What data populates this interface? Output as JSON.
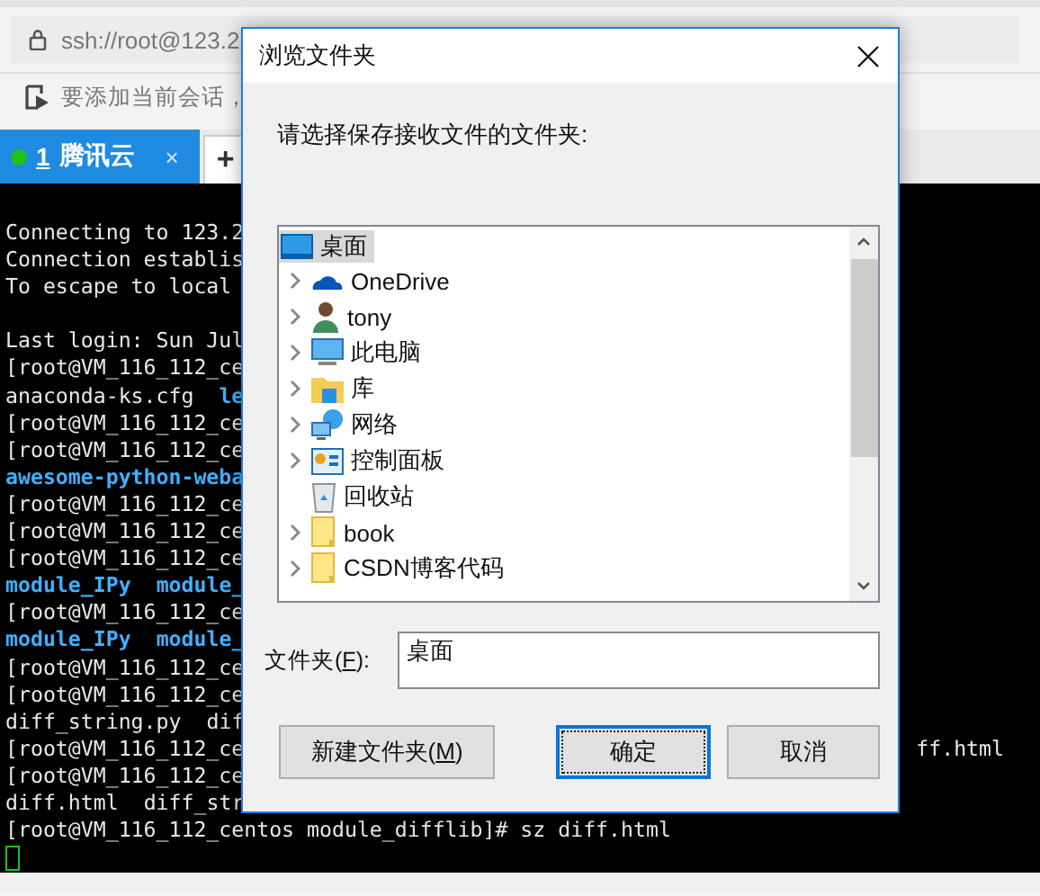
{
  "address_bar": {
    "value": "ssh://root@123.2"
  },
  "toolbar": {
    "hint": "要添加当前会话，"
  },
  "tabs": [
    {
      "number": "1",
      "label": "腾讯云",
      "close": "×",
      "selected": true
    }
  ],
  "new_tab": "+",
  "terminal": {
    "cursor": true,
    "lines": [
      {
        "segments": [
          {
            "text": "Connecting to 123.2",
            "kind": "plain"
          }
        ]
      },
      {
        "segments": [
          {
            "text": "Connection establis",
            "kind": "plain"
          }
        ]
      },
      {
        "segments": [
          {
            "text": "To escape to local",
            "kind": "plain"
          }
        ]
      },
      {
        "kind": "blank"
      },
      {
        "segments": [
          {
            "text": "Last login: Sun Jul",
            "kind": "plain"
          }
        ]
      },
      {
        "segments": [
          {
            "text": "[root@VM_116_112_ce",
            "kind": "plain"
          }
        ]
      },
      {
        "segments": [
          {
            "text": "anaconda-ks.cfg",
            "kind": "plain"
          },
          {
            "text": "le",
            "kind": "dir"
          }
        ]
      },
      {
        "segments": [
          {
            "text": "[root@VM_116_112_ce",
            "kind": "plain"
          }
        ]
      },
      {
        "segments": [
          {
            "text": "[root@VM_116_112_ce",
            "kind": "plain"
          }
        ]
      },
      {
        "segments": [
          {
            "text": "awesome-python-weba",
            "kind": "dir"
          }
        ]
      },
      {
        "segments": [
          {
            "text": "[root@VM_116_112_ce",
            "kind": "plain"
          }
        ]
      },
      {
        "segments": [
          {
            "text": "[root@VM_116_112_ce",
            "kind": "plain"
          }
        ]
      },
      {
        "segments": [
          {
            "text": "[root@VM_116_112_ce",
            "kind": "plain"
          }
        ]
      },
      {
        "segments": [
          {
            "text": "module_IPy",
            "kind": "dir"
          },
          {
            "text": "module_",
            "kind": "dir"
          }
        ]
      },
      {
        "segments": [
          {
            "text": "[root@VM_116_112_ce",
            "kind": "plain"
          }
        ]
      },
      {
        "segments": [
          {
            "text": "module_IPy",
            "kind": "dir"
          },
          {
            "text": "module_",
            "kind": "dir"
          }
        ]
      },
      {
        "segments": [
          {
            "text": "[root@VM_116_112_ce",
            "kind": "plain"
          }
        ]
      },
      {
        "segments": [
          {
            "text": "[root@VM_116_112_ce",
            "kind": "plain"
          }
        ]
      },
      {
        "segments": [
          {
            "text": "diff_string.py",
            "kind": "plain"
          },
          {
            "text": "dif",
            "kind": "plain"
          }
        ]
      },
      {
        "segments": [
          {
            "text": "[root@VM_116_112_ce",
            "kind": "plain"
          },
          {
            "text": "ff.html",
            "kind": "far"
          }
        ]
      },
      {
        "segments": [
          {
            "text": "[root@VM_116_112_ce",
            "kind": "plain"
          }
        ]
      },
      {
        "segments": [
          {
            "text": "diff.html",
            "kind": "plain"
          },
          {
            "text": "diff_str",
            "kind": "plain"
          }
        ]
      },
      {
        "segments": [
          {
            "text": "[root@VM_116_112_centos module_difflib]# sz diff.html",
            "kind": "plain"
          }
        ]
      }
    ]
  },
  "dialog": {
    "title": "浏览文件夹",
    "prompt": "请选择保存接收文件的文件夹:",
    "tree": {
      "label": "桌面",
      "kind": "desktop",
      "selected": true,
      "children": [
        {
          "label": "OneDrive",
          "kind": "cloud",
          "expandable": true,
          "selected": false
        },
        {
          "label": "tony",
          "kind": "user",
          "expandable": true,
          "selected": false
        },
        {
          "label": "此电脑",
          "kind": "computer",
          "expandable": true,
          "selected": false
        },
        {
          "label": "库",
          "kind": "library",
          "expandable": true,
          "selected": false
        },
        {
          "label": "网络",
          "kind": "network",
          "expandable": true,
          "selected": false
        },
        {
          "label": "控制面板",
          "kind": "panel",
          "expandable": true,
          "selected": false
        },
        {
          "label": "回收站",
          "kind": "bin",
          "expandable": false,
          "selected": false
        },
        {
          "label": "book",
          "kind": "folder",
          "expandable": true,
          "selected": false
        },
        {
          "label": "CSDN博客代码",
          "kind": "folder",
          "expandable": true,
          "selected": false
        }
      ]
    },
    "folder_field": {
      "label_before": "文件夹(",
      "mnemonic": "F",
      "label_after": "):",
      "value": "桌面"
    },
    "buttons": [
      {
        "text_before": "新建文件夹(",
        "mnemonic": "M",
        "text_after": ")",
        "default": false
      },
      {
        "text_before": "确定",
        "default": true
      },
      {
        "text_before": "取消",
        "default": false
      }
    ]
  }
}
